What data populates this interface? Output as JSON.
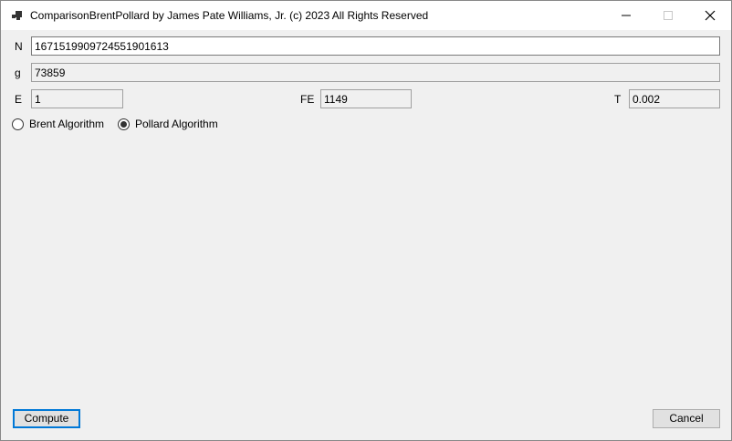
{
  "window": {
    "title": "ComparisonBrentPollard by James Pate Williams, Jr. (c) 2023 All Rights Reserved",
    "icons": [
      "app-icon",
      "minimize-icon",
      "maximize-icon",
      "close-icon"
    ]
  },
  "form": {
    "n_label": "N",
    "n_value": "1671519909724551901613",
    "g_label": "g",
    "g_value": "73859",
    "e_label": "E",
    "e_value": "1",
    "fe_label": "FE",
    "fe_value": "1149",
    "t_label": "T",
    "t_value": "0.002"
  },
  "algorithms": {
    "options": [
      {
        "label": "Brent Algorithm",
        "selected": false
      },
      {
        "label": "Pollard Algorithm",
        "selected": true
      }
    ]
  },
  "buttons": {
    "compute": "Compute",
    "cancel": "Cancel"
  },
  "colors": {
    "window_bg": "#f0f0f0",
    "default_button_border": "#0078d7"
  }
}
